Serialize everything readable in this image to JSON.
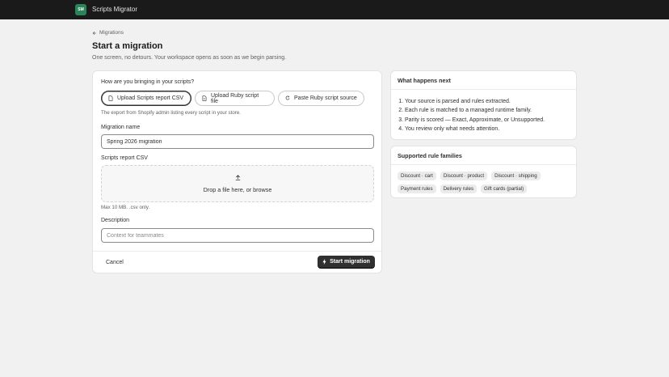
{
  "app": {
    "logo_text": "SM",
    "name": "Scripts Migrator",
    "brand_color": "#29845a"
  },
  "header": {
    "breadcrumb": "Migrations",
    "title": "Start a migration",
    "subtitle": "One screen, no detours. Your workspace opens as soon as we begin parsing."
  },
  "form": {
    "question": "How are you bringing in your scripts?",
    "options": [
      {
        "label": "Upload Scripts report CSV",
        "icon": "document-icon",
        "selected": true
      },
      {
        "label": "Upload Ruby script file",
        "icon": "file-icon",
        "selected": false
      },
      {
        "label": "Paste Ruby script source",
        "icon": "clipboard-icon",
        "selected": false
      }
    ],
    "help_text": "The export from Shopify admin listing every script in your store.",
    "name_label": "Migration name",
    "name_value": "Spring 2026 migration",
    "csv_label": "Scripts report CSV",
    "dropzone_text": "Drop a file here, or browse",
    "dropzone_hint": "Max 10 MB. .csv only.",
    "description_label": "Description",
    "description_placeholder": "Context for teammates",
    "cancel_label": "Cancel",
    "start_label": "Start migration"
  },
  "next_steps": {
    "title": "What happens next",
    "items": [
      "Your source is parsed and rules extracted.",
      "Each rule is matched to a managed runtime family.",
      "Parity is scored — Exact, Approximate, or Unsupported.",
      "You review only what needs attention."
    ]
  },
  "families": {
    "title": "Supported rule families",
    "items": [
      "Discount · cart",
      "Discount · product",
      "Discount · shipping",
      "Payment rules",
      "Delivery rules",
      "Gift cards (partial)"
    ]
  }
}
